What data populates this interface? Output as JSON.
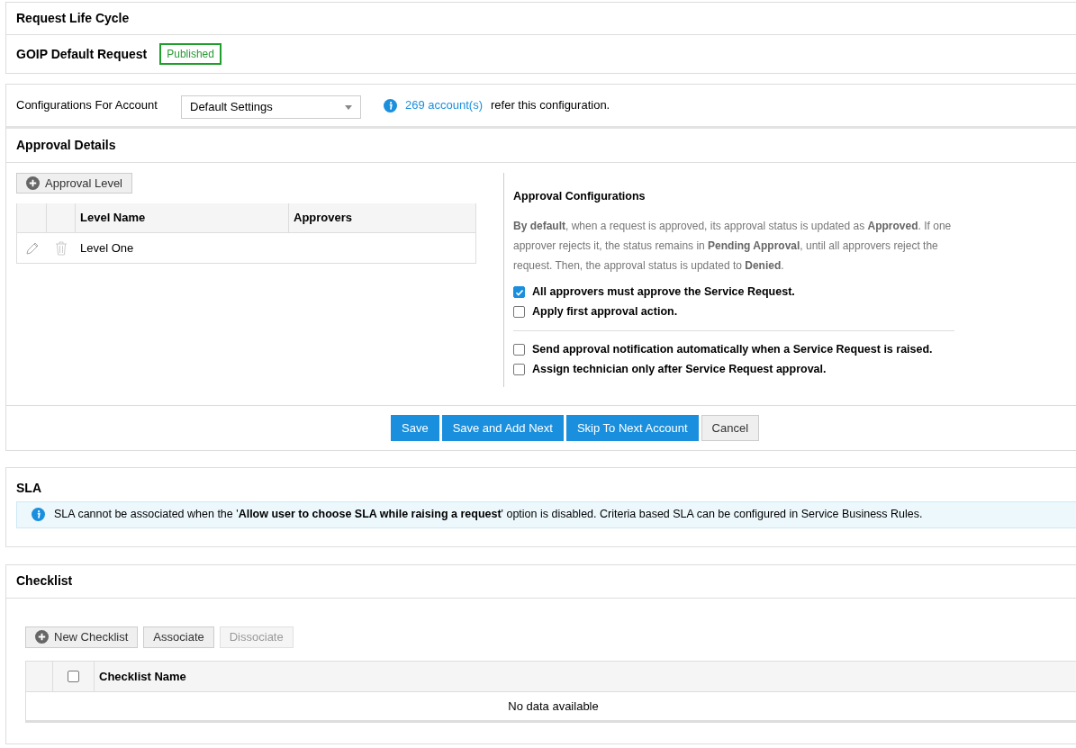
{
  "page_title": "Request Life Cycle",
  "template": {
    "name": "GOIP Default Request",
    "status": "Published"
  },
  "configuration": {
    "label": "Configurations For Account",
    "select_value": "Default Settings",
    "link": "269 account(s)",
    "note": "refer this configuration."
  },
  "approval": {
    "title": "Approval Details",
    "add_button": "Approval Level",
    "table": {
      "columns": [
        "Level Name",
        "Approvers"
      ],
      "rows": [
        {
          "level_name": "Level One",
          "approvers": ""
        }
      ]
    },
    "config_title": "Approval Configurations",
    "description": "**By default**, when a request is approved, its approval status is updated as **Approved**. If one approver rejects it, the status remains in **Pending Approval**, until all approvers reject the request. Then, the approval status is updated to **Denied**.",
    "options": [
      {
        "label": "All approvers must approve the Service Request.",
        "checked": true
      },
      {
        "label": "Apply first approval action.",
        "checked": false
      }
    ],
    "extra_options": [
      {
        "label": "Send approval notification automatically when a Service Request is raised.",
        "checked": false
      },
      {
        "label": "Assign technician only after Service Request approval.",
        "checked": false
      }
    ],
    "buttons": [
      {
        "label": "Save",
        "kind": "primary"
      },
      {
        "label": "Save and Add Next",
        "kind": "primary"
      },
      {
        "label": "Skip To Next Account",
        "kind": "primary"
      },
      {
        "label": "Cancel",
        "kind": "secondary"
      }
    ]
  },
  "sla": {
    "title": "SLA",
    "message": "SLA cannot be associated when the '**Allow user to choose SLA while raising a request**' option is disabled. Criteria based SLA can be configured in Service Business Rules."
  },
  "checklist": {
    "title": "Checklist",
    "buttons": [
      {
        "label": "New Checklist",
        "kind": "add",
        "disabled": false
      },
      {
        "label": "Associate",
        "kind": "plain",
        "disabled": false
      },
      {
        "label": "Dissociate",
        "kind": "plain",
        "disabled": true
      }
    ],
    "select_all_checked": false,
    "columns": [
      "Checklist Name"
    ],
    "empty_message": "No data available"
  }
}
